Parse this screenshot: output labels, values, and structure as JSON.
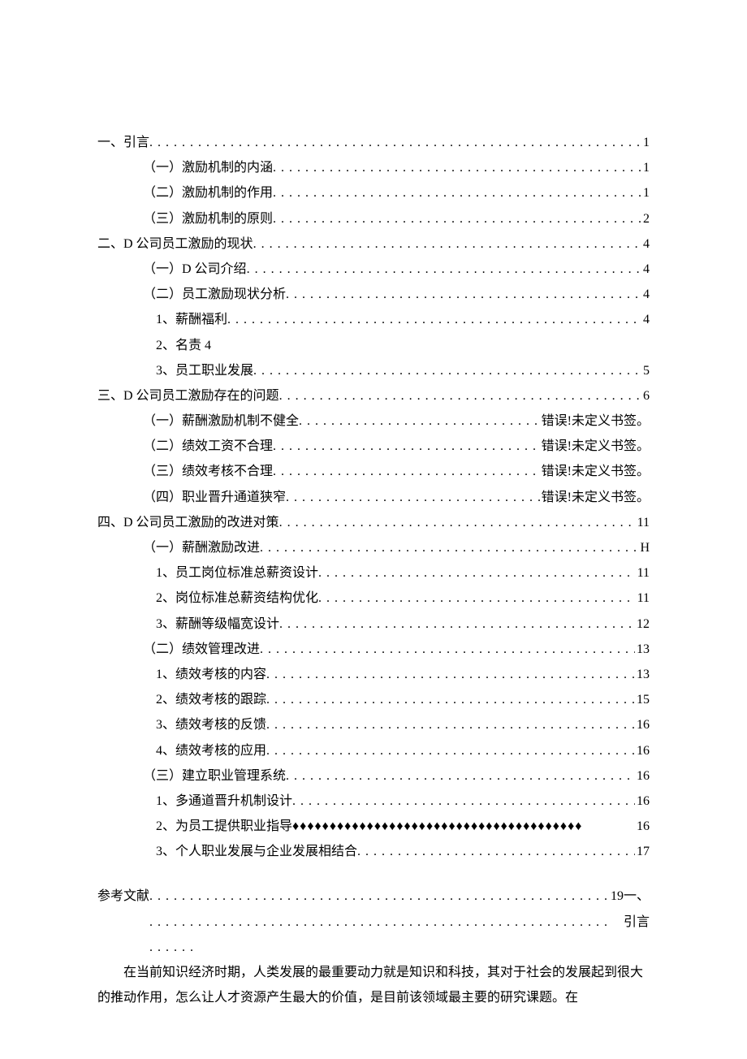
{
  "leaders": {
    "dots": ". . . . . . . . . . . . . . . . . . . . . . . . . . . . . . . . . . . . . . . . . . . . . . . . . . . . . . . . . . . . . . . . . . . . . . . . . . . . . . . . . . . . . . . . . . . . . . . . . . . . . . . . . . . . . . . . . . . . . . . .",
    "diamonds": "♦♦♦♦♦♦♦♦♦♦♦♦♦♦♦♦♦♦♦♦♦♦♦♦♦♦♦♦♦♦♦♦♦♦♦♦♦♦♦"
  },
  "toc": [
    {
      "level": 0,
      "label": "一、引言",
      "page": "1",
      "leader": "dots"
    },
    {
      "level": 1,
      "label": "（一）激励机制的内涵",
      "page": "1",
      "leader": "dots"
    },
    {
      "level": 1,
      "label": "（二）激励机制的作用",
      "page": "1",
      "leader": "dots"
    },
    {
      "level": 1,
      "label": "（三）激励机制的原则",
      "page": "2",
      "leader": "dots"
    },
    {
      "level": 0,
      "label": "二、D 公司员工激励的现状",
      "page": "4",
      "leader": "dots"
    },
    {
      "level": 1,
      "label": "（一）D 公司介绍",
      "page": "4",
      "leader": "dots"
    },
    {
      "level": 1,
      "label": "（二）员工激励现状分析",
      "page": "4",
      "leader": "dots"
    },
    {
      "level": 2,
      "label": "1、薪酬福利",
      "page": "4",
      "leader": "dots"
    },
    {
      "level": 2,
      "label": "2、名责 4",
      "page": "",
      "leader": "none"
    },
    {
      "level": 2,
      "label": "3、员工职业发展",
      "page": "5",
      "leader": "dots"
    },
    {
      "level": 0,
      "label": "三、D 公司员工激励存在的问题",
      "page": "6",
      "leader": "dots"
    },
    {
      "level": 1,
      "label": "（一）薪酬激励机制不健全",
      "page": "错误!未定义书签。",
      "leader": "dots"
    },
    {
      "level": 1,
      "label": "（二）绩效工资不合理",
      "page": "错误!未定义书签。",
      "leader": "dots"
    },
    {
      "level": 1,
      "label": "（三）绩效考核不合理",
      "page": "错误!未定义书签。",
      "leader": "dots"
    },
    {
      "level": 1,
      "label": "（四）职业晋升通道狭窄",
      "page": "错误!未定义书签。",
      "leader": "dots"
    },
    {
      "level": 0,
      "label": "四、D 公司员工激励的改进对策",
      "page": "11",
      "leader": "dots"
    },
    {
      "level": 1,
      "label": "（一）薪酬激励改进",
      "page": "H",
      "leader": "dots"
    },
    {
      "level": 2,
      "label": "1、员工岗位标准总薪资设计",
      "page": "11",
      "leader": "dots"
    },
    {
      "level": 2,
      "label": "2、岗位标准总薪资结构优化",
      "page": "11",
      "leader": "dots"
    },
    {
      "level": 2,
      "label": "3、薪酬等级幅宽设计",
      "page": "12",
      "leader": "dots"
    },
    {
      "level": 1,
      "label": "（二）绩效管理改进",
      "page": "13",
      "leader": "dots"
    },
    {
      "level": 2,
      "label": "1、绩效考核的内容",
      "page": "13",
      "leader": "dots"
    },
    {
      "level": 2,
      "label": "2、绩效考核的跟踪",
      "page": "15",
      "leader": "dots"
    },
    {
      "level": 2,
      "label": "3、绩效考核的反馈",
      "page": "16",
      "leader": "dots"
    },
    {
      "level": 2,
      "label": "4、绩效考核的应用",
      "page": "16",
      "leader": "dots"
    },
    {
      "level": 1,
      "label": "（三）建立职业管理系统",
      "page": "16",
      "leader": "dots"
    },
    {
      "level": 2,
      "label": "1、多通道晋升机制设计",
      "page": "16",
      "leader": "dots"
    },
    {
      "level": 2,
      "label": "2、为员工提供职业指导",
      "page": "16",
      "leader": "diamonds"
    },
    {
      "level": 2,
      "label": "3、个人职业发展与企业发展相结合",
      "page": "17",
      "leader": "dots"
    }
  ],
  "refsLine": {
    "label": "参考文献",
    "page": "19",
    "tail": " 一、引言"
  },
  "body": {
    "p1": "在当前知识经济时期，人类发展的最重要动力就是知识和科技，其对于社会的发展起到很大的推动作用，怎么让人才资源产生最大的价值，是目前该领域最主要的研究课题。在"
  }
}
